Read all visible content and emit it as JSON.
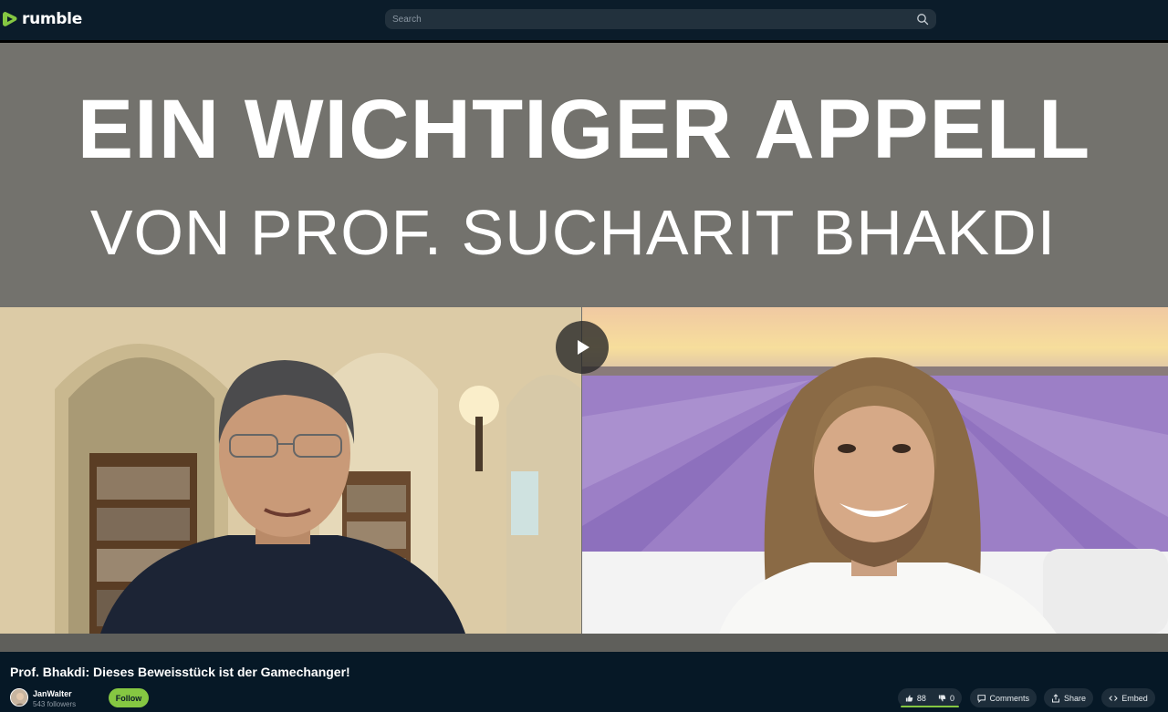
{
  "app": {
    "brand": "rumble",
    "accent": "#85c742"
  },
  "search": {
    "placeholder": "Search"
  },
  "video": {
    "overlay_line1": "EIN WICHTIGER APPELL",
    "overlay_line2": "VON PROF. SUCHARIT BHAKDI",
    "title": "Prof. Bhakdi: Dieses Beweisstück ist der Gamechanger!"
  },
  "channel": {
    "name": "JanWalter",
    "followers": "543 followers",
    "follow_label": "Follow"
  },
  "actions": {
    "likes": "88",
    "dislikes": "0",
    "comments_label": "Comments",
    "share_label": "Share",
    "embed_label": "Embed"
  }
}
